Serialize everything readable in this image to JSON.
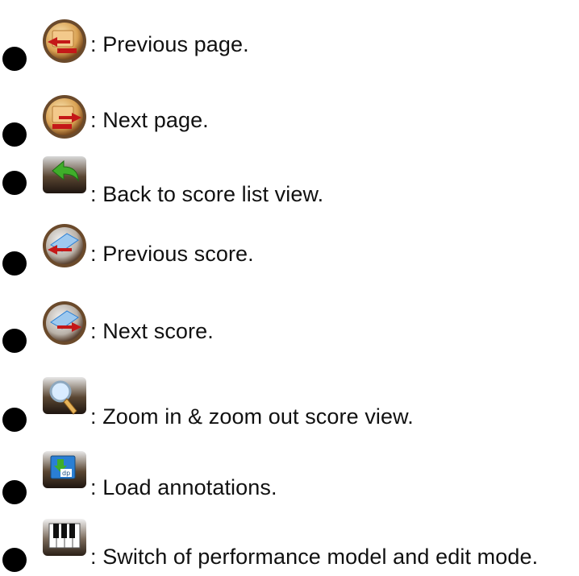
{
  "items": [
    {
      "icon": "previous-page-icon",
      "label": ": Previous page."
    },
    {
      "icon": "next-page-icon",
      "label": ": Next page."
    },
    {
      "icon": "back-arrow-icon",
      "label": ": Back to score list view."
    },
    {
      "icon": "previous-score-icon",
      "label": ": Previous score."
    },
    {
      "icon": "next-score-icon",
      "label": ": Next score."
    },
    {
      "icon": "magnifier-icon",
      "label": ": Zoom in & zoom out score view."
    },
    {
      "icon": "load-annotations-icon",
      "label": ": Load annotations."
    },
    {
      "icon": "piano-keys-icon",
      "label": ": Switch of performance model and edit mode."
    }
  ],
  "colors": {
    "bullet": "#000000",
    "text": "#111111",
    "accent_red": "#c41818",
    "accent_green": "#3fae2a",
    "accent_blue": "#2a7fd4"
  }
}
